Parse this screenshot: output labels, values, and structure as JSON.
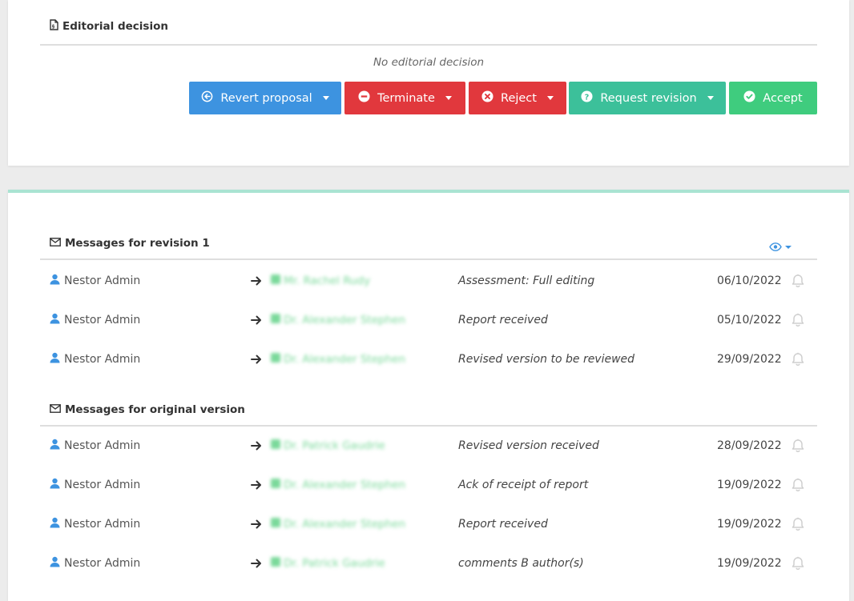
{
  "editorial": {
    "title": "Editorial decision",
    "no_decision": "No editorial decision",
    "buttons": {
      "revert": "Revert proposal",
      "terminate": "Terminate",
      "reject": "Reject",
      "request_revision": "Request revision",
      "accept": "Accept"
    }
  },
  "messages": {
    "revision_title": "Messages for revision 1",
    "original_title": "Messages for original version",
    "revision_rows": [
      {
        "sender": "Nestor Admin",
        "recipient": "Mr. Rachel Rudy",
        "recipient_icon": "envelope-icon",
        "subject": "Assessment: Full editing",
        "date": "06/10/2022"
      },
      {
        "sender": "Nestor Admin",
        "recipient": "Dr. Alexander Stephen",
        "recipient_icon": "user-icon",
        "subject": "Report received",
        "date": "05/10/2022"
      },
      {
        "sender": "Nestor Admin",
        "recipient": "Dr. Alexander Stephen",
        "recipient_icon": "user-icon",
        "subject": "Revised version to be reviewed",
        "date": "29/09/2022"
      }
    ],
    "original_rows": [
      {
        "sender": "Nestor Admin",
        "recipient": "Dr. Patrick Gaudrie",
        "recipient_icon": "pen-icon",
        "subject": "Revised version received",
        "date": "28/09/2022"
      },
      {
        "sender": "Nestor Admin",
        "recipient": "Dr. Alexander Stephen",
        "recipient_icon": "user-icon",
        "subject": "Ack of receipt of report",
        "date": "19/09/2022"
      },
      {
        "sender": "Nestor Admin",
        "recipient": "Dr. Alexander Stephen",
        "recipient_icon": "user-icon",
        "subject": "Report received",
        "date": "19/09/2022"
      },
      {
        "sender": "Nestor Admin",
        "recipient": "Dr. Patrick Gaudrie",
        "recipient_icon": "pen-icon",
        "subject": "comments B author(s)",
        "date": "19/09/2022"
      }
    ]
  },
  "colors": {
    "blue": "#3d93e0",
    "red": "#e1383d",
    "teal": "#3cc09a",
    "green": "#3fcc7e",
    "accent_border": "#a9e3d2"
  }
}
